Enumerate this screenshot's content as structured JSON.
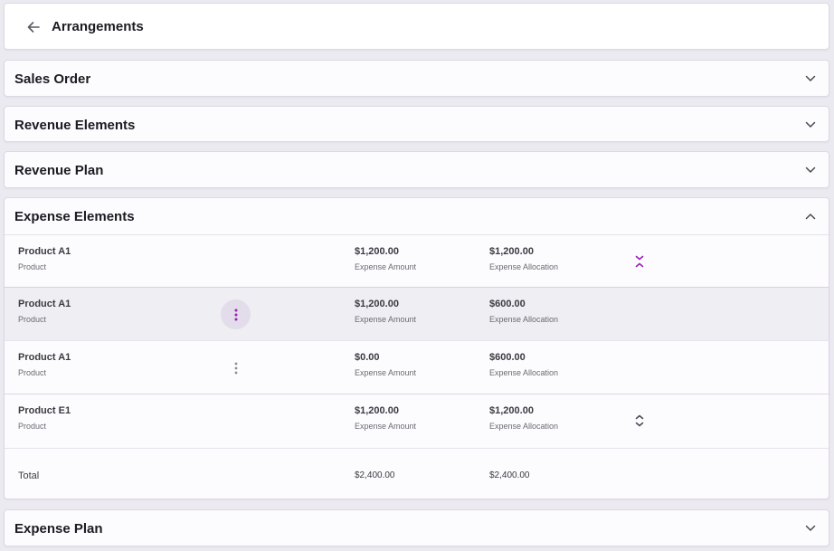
{
  "header": {
    "title": "Arrangements"
  },
  "sections": {
    "sales_order": {
      "title": "Sales Order"
    },
    "revenue_elements": {
      "title": "Revenue Elements"
    },
    "revenue_plan": {
      "title": "Revenue Plan"
    },
    "expense_elements": {
      "title": "Expense Elements"
    },
    "expense_plan": {
      "title": "Expense Plan"
    }
  },
  "expense_rows": [
    {
      "name": "Product A1",
      "type": "Product",
      "amount": "$1,200.00",
      "amount_label": "Expense Amount",
      "allocation": "$1,200.00",
      "allocation_label": "Expense Allocation"
    },
    {
      "name": "Product A1",
      "type": "Product",
      "amount": "$1,200.00",
      "amount_label": "Expense Amount",
      "allocation": "$600.00",
      "allocation_label": "Expense Allocation"
    },
    {
      "name": "Product A1",
      "type": "Product",
      "amount": "$0.00",
      "amount_label": "Expense Amount",
      "allocation": "$600.00",
      "allocation_label": "Expense Allocation"
    },
    {
      "name": "Product E1",
      "type": "Product",
      "amount": "$1,200.00",
      "amount_label": "Expense Amount",
      "allocation": "$1,200.00",
      "allocation_label": "Expense Allocation"
    }
  ],
  "total": {
    "label": "Total",
    "amount": "$2,400.00",
    "allocation": "$2,400.00"
  },
  "colors": {
    "accent": "#9a1fb5",
    "muted_icon": "#8d8a94"
  }
}
